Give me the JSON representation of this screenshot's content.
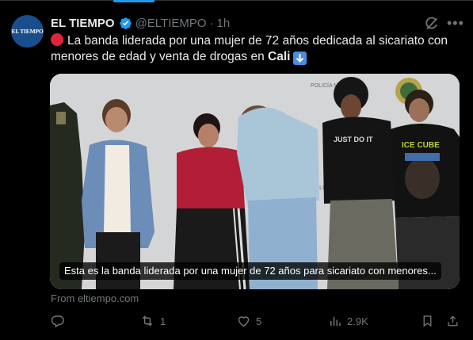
{
  "account": {
    "avatar_text": "EL TIEMPO",
    "name": "EL TIEMPO",
    "handle": "@ELTIEMPO",
    "separator": "·",
    "time": "1h"
  },
  "tweet": {
    "text_main": "La banda liderada por una mujer de 72 años dedicada al sicariato con menores de edad y venta de drogas en ",
    "text_bold": "Cali"
  },
  "card": {
    "caption": "Esta es la banda liderada por una mujer de 72 años para sicariato con menores...",
    "backdrop_text_1": "POLICÍA NACIONAL",
    "backdrop_text_2": "POLICÍA NACIONAL",
    "shirt_text_1": "ICE CUBE",
    "shirt_text_2": "JUST DO IT",
    "source": "From eltiempo.com"
  },
  "actions": {
    "replies": "",
    "reposts": "1",
    "likes": "5",
    "views": "2.9K"
  },
  "colors": {
    "background": "#000000",
    "text": "#e7e9ea",
    "muted": "#71767b",
    "accent": "#1d9bf0"
  },
  "icons": [
    "verified-badge-icon",
    "grok-icon",
    "more-icon",
    "red-circle-emoji-icon",
    "down-arrow-emoji-icon",
    "reply-icon",
    "repost-icon",
    "like-icon",
    "views-icon",
    "bookmark-icon",
    "share-icon"
  ]
}
